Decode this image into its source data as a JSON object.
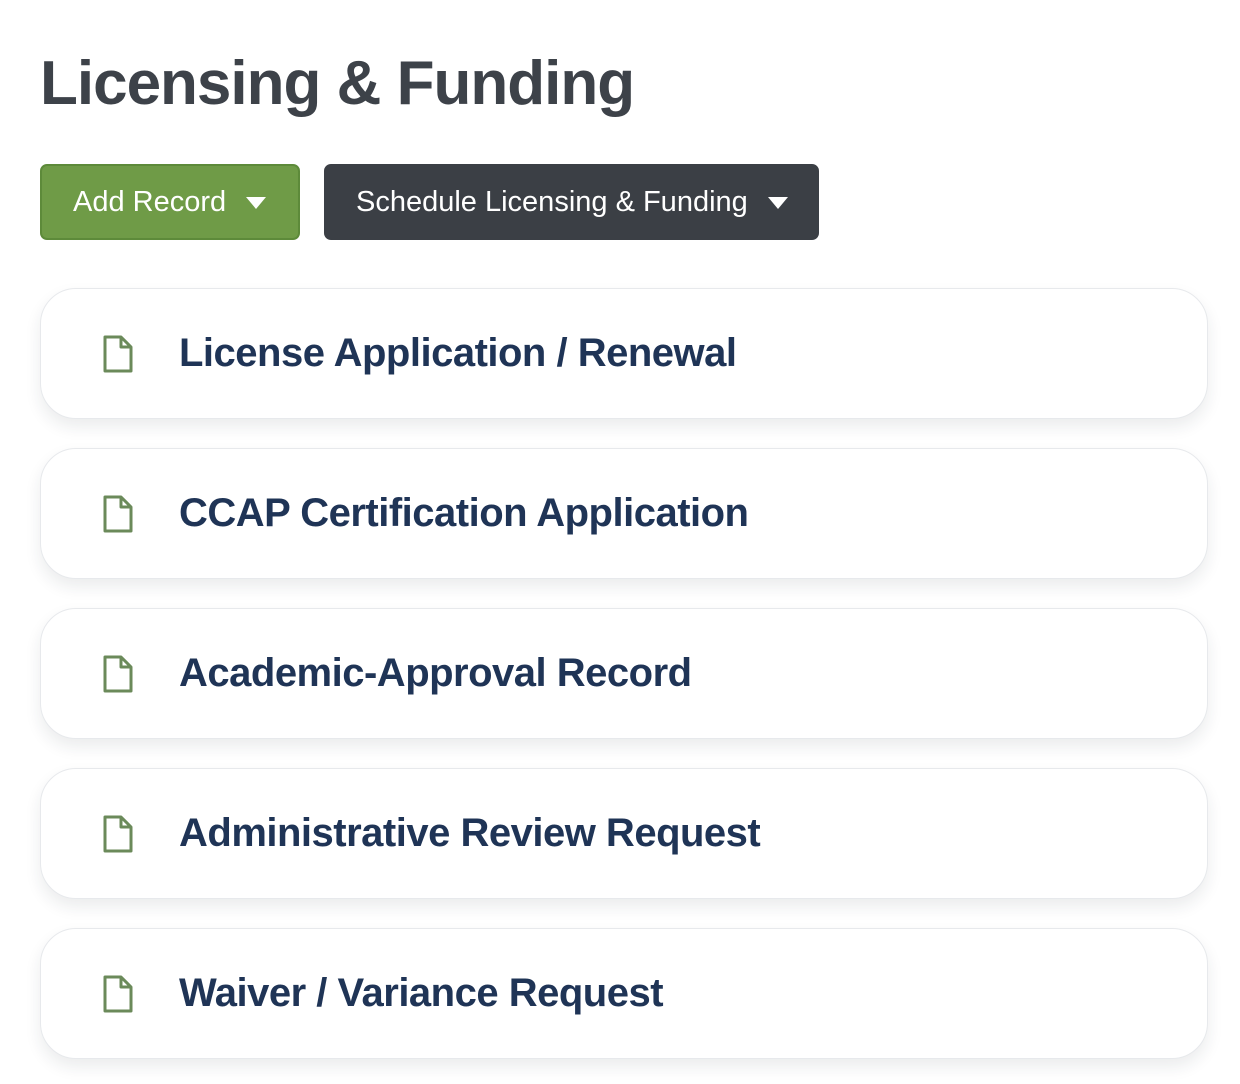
{
  "page": {
    "title": "Licensing & Funding"
  },
  "toolbar": {
    "add_record_label": "Add Record",
    "schedule_label": "Schedule Licensing & Funding"
  },
  "records": [
    {
      "label": "License Application / Renewal",
      "icon": "document-icon"
    },
    {
      "label": "CCAP Certification Application",
      "icon": "document-icon"
    },
    {
      "label": "Academic-Approval Record",
      "icon": "document-icon"
    },
    {
      "label": "Administrative Review Request",
      "icon": "document-icon"
    },
    {
      "label": "Waiver / Variance Request",
      "icon": "document-icon"
    }
  ],
  "colors": {
    "add_button": "#6f9b47",
    "schedule_button": "#3b3f45",
    "record_text": "#1f3456",
    "icon": "#6b8a5a",
    "title_text": "#3d4249"
  }
}
